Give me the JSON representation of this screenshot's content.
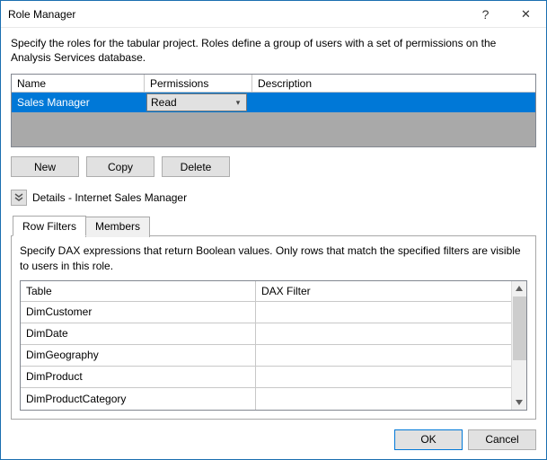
{
  "window": {
    "title": "Role Manager",
    "help": "?",
    "close": "✕"
  },
  "intro": "Specify the roles for the tabular project. Roles define a group of users with a set of permissions on the Analysis Services database.",
  "rolesGrid": {
    "columns": {
      "name": "Name",
      "permissions": "Permissions",
      "description": "Description"
    },
    "rows": [
      {
        "name": "Sales Manager",
        "permissions": "Read",
        "description": ""
      }
    ]
  },
  "buttons": {
    "new": "New",
    "copy": "Copy",
    "delete": "Delete"
  },
  "details": {
    "label": "Details - Internet Sales Manager"
  },
  "tabs": {
    "rowFilters": "Row Filters",
    "members": "Members"
  },
  "panel": {
    "intro": "Specify DAX expressions that return Boolean values. Only rows that match the specified filters are visible to users in this role.",
    "columns": {
      "table": "Table",
      "dax": "DAX Filter"
    },
    "rows": [
      {
        "table": "DimCustomer",
        "dax": ""
      },
      {
        "table": "DimDate",
        "dax": ""
      },
      {
        "table": "DimGeography",
        "dax": ""
      },
      {
        "table": "DimProduct",
        "dax": ""
      },
      {
        "table": "DimProductCategory",
        "dax": ""
      }
    ]
  },
  "footer": {
    "ok": "OK",
    "cancel": "Cancel"
  }
}
